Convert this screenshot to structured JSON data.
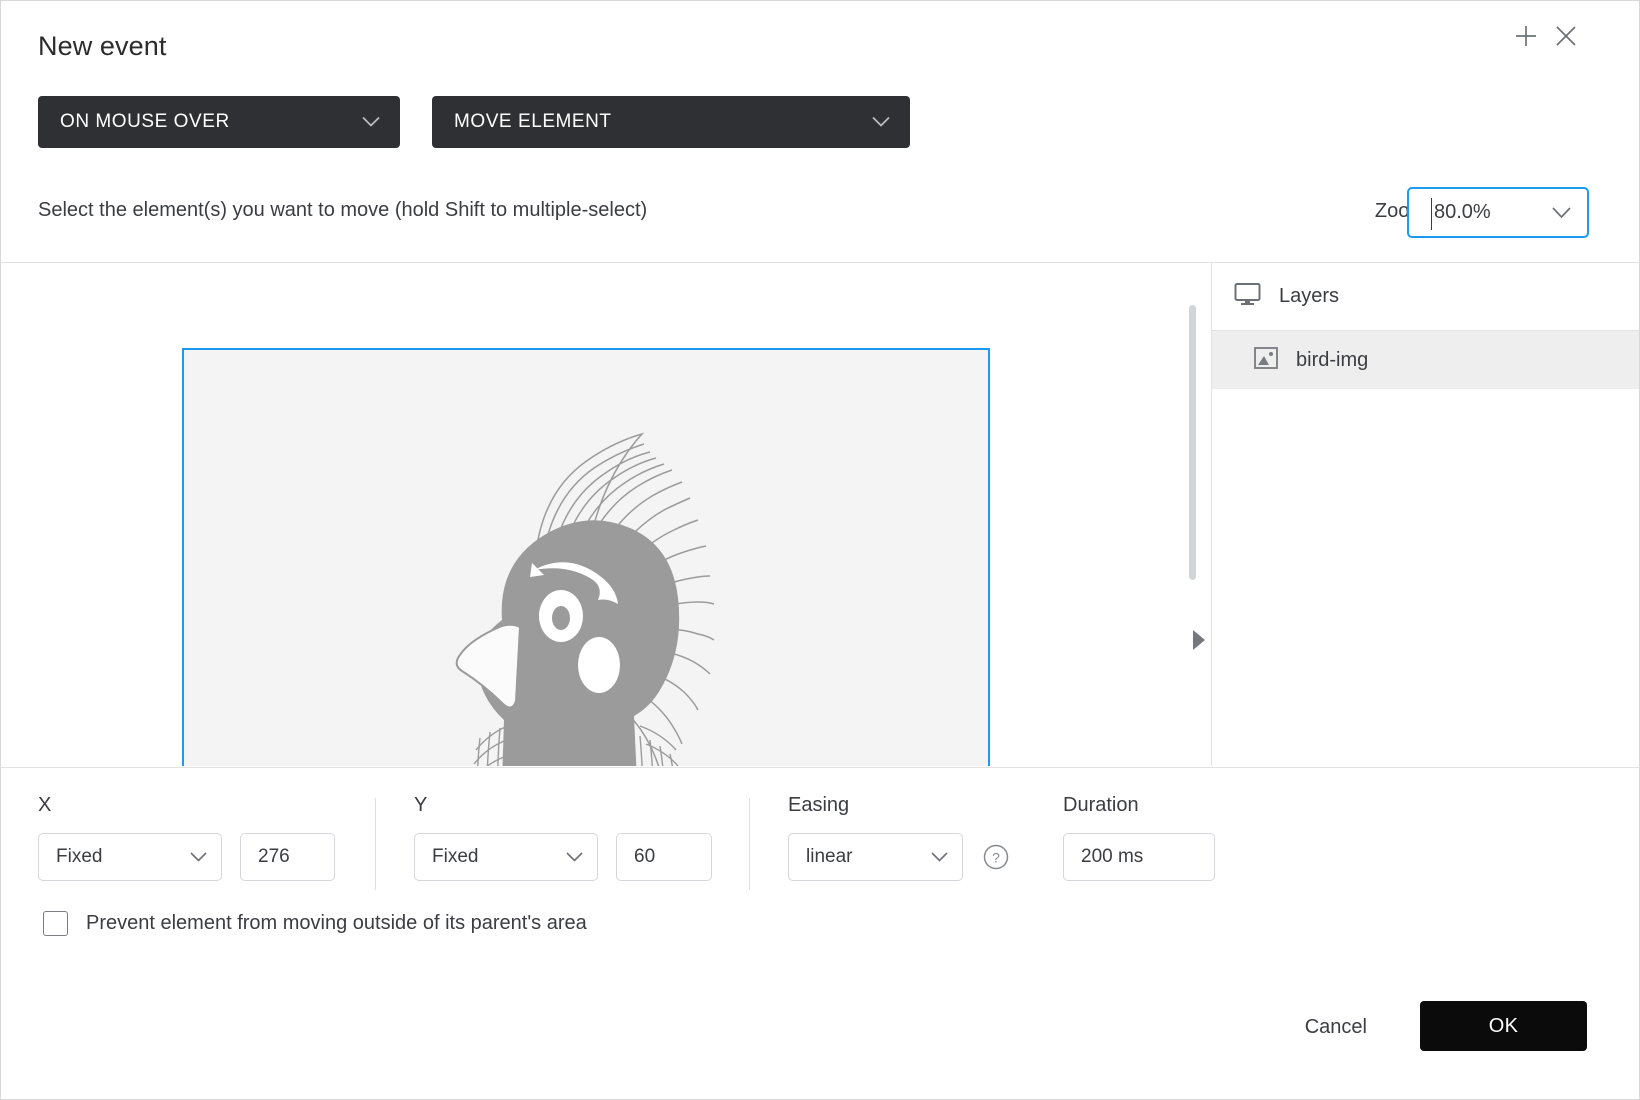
{
  "header": {
    "title": "New event",
    "add_icon": "plus-icon",
    "close_icon": "close-icon"
  },
  "action_bar": {
    "trigger": {
      "label": "ON MOUSE OVER",
      "caret_icon": "chevron-down-icon"
    },
    "action": {
      "label": "MOVE ELEMENT",
      "caret_icon": "chevron-down-icon"
    }
  },
  "instruction": {
    "text": "Select the element(s) you want to move (hold Shift to multiple-select)"
  },
  "zoom": {
    "label": "Zoom",
    "value": "80.0%",
    "caret_icon": "chevron-down-icon"
  },
  "canvas": {
    "selection_color": "#1a9bf0",
    "artboard_bg": "#f4f4f4",
    "illustration_name": "bird-illustration",
    "scrollbar_name": "stage-vertical-scrollbar",
    "collapse_icon": "triangle-right-icon"
  },
  "layers_panel": {
    "header_label": "Layers",
    "header_icon": "monitor-icon",
    "items": [
      {
        "label": "bird-img",
        "icon": "image-icon",
        "selected": true
      }
    ]
  },
  "properties": {
    "x": {
      "label": "X",
      "mode": "Fixed",
      "value": "276",
      "caret_icon": "chevron-down-icon"
    },
    "y": {
      "label": "Y",
      "mode": "Fixed",
      "value": "60",
      "caret_icon": "chevron-down-icon"
    },
    "easing": {
      "label": "Easing",
      "value": "linear",
      "caret_icon": "chevron-down-icon",
      "help_icon": "question-circle-icon"
    },
    "duration": {
      "label": "Duration",
      "value": "200 ms"
    },
    "prevent": {
      "label": "Prevent element from moving outside of its parent's area",
      "checked": false
    }
  },
  "footer": {
    "cancel_label": "Cancel",
    "ok_label": "OK",
    "ok_bg": "#0b0b0b"
  }
}
